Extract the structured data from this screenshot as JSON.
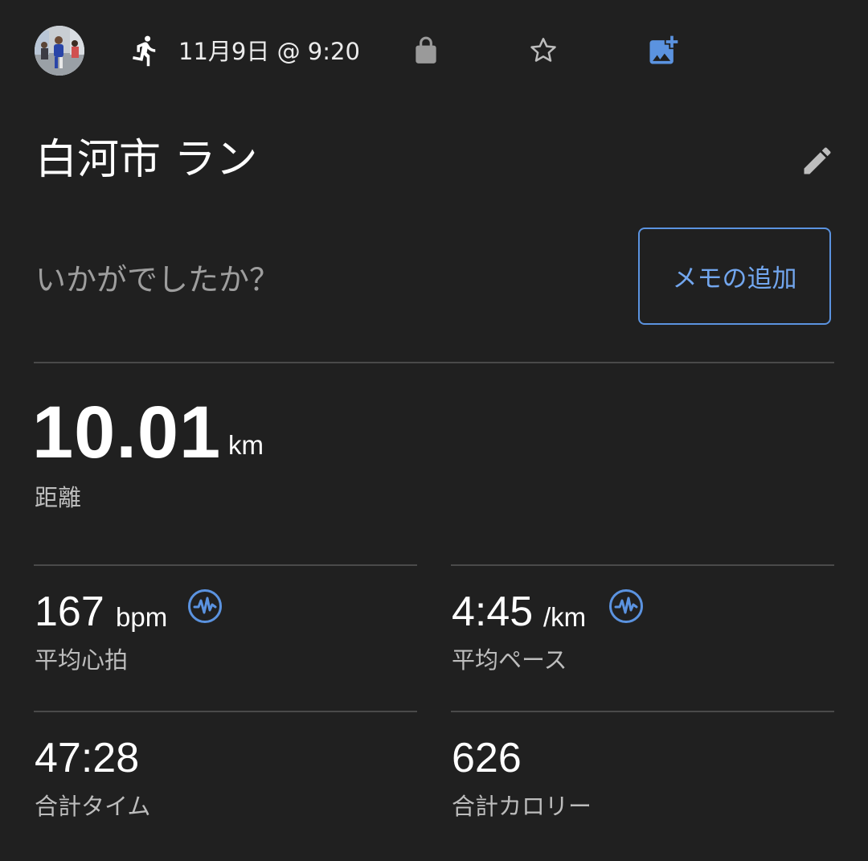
{
  "header": {
    "date_time": "11月9日 @ 9:20",
    "icons": {
      "avatar": "user-photo",
      "activity": "running-icon",
      "privacy": "lock-icon",
      "favorite": "star-outline-icon",
      "add_photo": "add-photo-icon"
    }
  },
  "activity": {
    "title": "白河市 ラン",
    "edit_icon": "pencil-icon"
  },
  "feedback": {
    "question": "いかがでしたか？",
    "memo_button_label": "メモの追加"
  },
  "stats": {
    "distance": {
      "value": "10.01",
      "unit": "km",
      "label": "距離"
    },
    "avg_heart_rate": {
      "value": "167",
      "unit": "bpm",
      "label": "平均心拍",
      "icon": "pulse-icon"
    },
    "avg_pace": {
      "value": "4:45",
      "unit": "/km",
      "label": "平均ペース",
      "icon": "pulse-icon"
    },
    "total_time": {
      "value": "47:28",
      "label": "合計タイム"
    },
    "total_calories": {
      "value": "626",
      "label": "合計カロリー"
    }
  },
  "colors": {
    "background": "#202020",
    "accent": "#5b93e0",
    "divider": "#4a4a4a",
    "label": "#bdbdbd",
    "muted": "#9e9e9e"
  }
}
